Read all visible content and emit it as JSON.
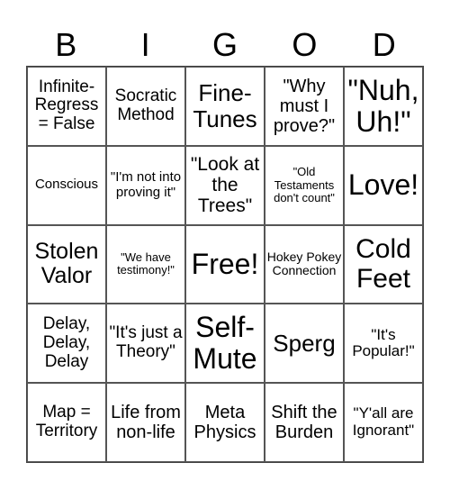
{
  "header": [
    "B",
    "I",
    "G",
    "O",
    "D"
  ],
  "cells": [
    "Infinite-Regress = False",
    "Socratic Method",
    "Fine-Tunes",
    "\"Why must I prove?\"",
    "\"Nuh, Uh!\"",
    "Conscious",
    "\"I'm not into proving it\"",
    "\"Look at the Trees\"",
    "\"Old Testaments don't count\"",
    "Love!",
    "Stolen Valor",
    "\"We have testimony!\"",
    "Free!",
    "Hokey Pokey Connection",
    "Cold Feet",
    "Delay, Delay, Delay",
    "\"It's just a Theory\"",
    "Self-Mute",
    "Sperg",
    "\"It's Popular!\"",
    "Map = Territory",
    "Life from non-life",
    "Meta Physics",
    "Shift the Burden",
    "\"Y'all are Ignorant\""
  ]
}
